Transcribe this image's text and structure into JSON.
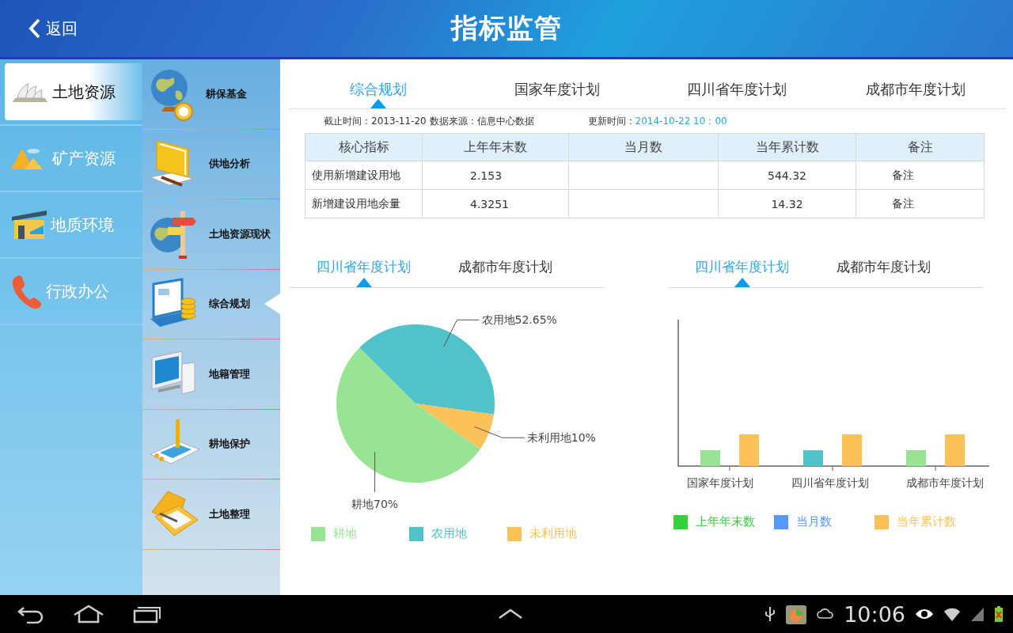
{
  "header": {
    "back": "返回",
    "title": "指标监管"
  },
  "nav": [
    {
      "label": "土地资源",
      "selected": true
    },
    {
      "label": "矿产资源",
      "selected": false
    },
    {
      "label": "地质环境",
      "selected": false
    },
    {
      "label": "行政办公",
      "selected": false
    }
  ],
  "subnav": [
    {
      "label": "耕保基金",
      "selected": false
    },
    {
      "label": "供地分析",
      "selected": false
    },
    {
      "label": "土地资源现状",
      "selected": false
    },
    {
      "label": "综合规划",
      "selected": true
    },
    {
      "label": "地籍管理",
      "selected": false
    },
    {
      "label": "耕地保护",
      "selected": false
    },
    {
      "label": "土地整理",
      "selected": false
    }
  ],
  "tabs": [
    {
      "label": "综合规划",
      "selected": true
    },
    {
      "label": "国家年度计划",
      "selected": false
    },
    {
      "label": "四川省年度计划",
      "selected": false
    },
    {
      "label": "成都市年度计划",
      "selected": false
    }
  ],
  "info": {
    "source": "截止时间：2013-11-20 数据来源：信息中心数据",
    "updated_label": "更新时间：",
    "updated_value": "2014-10-22 10：00"
  },
  "table": {
    "columns": [
      "核心指标",
      "上年年末数",
      "当月数",
      "当年累计数",
      "备注"
    ],
    "rows": [
      [
        "使用新增建设用地",
        "2.153",
        "",
        "544.32",
        "备注"
      ],
      [
        "新增建设用地余量",
        "4.3251",
        "",
        "14.32",
        "备注"
      ]
    ]
  },
  "pie_panel": {
    "tabs": [
      {
        "label": "四川省年度计划",
        "selected": true
      },
      {
        "label": "成都市年度计划",
        "selected": false
      }
    ],
    "chart_data": {
      "type": "pie",
      "values": [
        70,
        52.65,
        10
      ],
      "value_labels": [
        "耕地70%",
        "农用地52.65%",
        "未利用地10%"
      ]
    },
    "legend": [
      {
        "label": "耕地",
        "color": "#97e493"
      },
      {
        "label": "农用地",
        "color": "#4fc3c8"
      },
      {
        "label": "未利用地",
        "color": "#fdc159"
      }
    ]
  },
  "bar_panel": {
    "tabs": [
      {
        "label": "四川省年度计划",
        "selected": true
      },
      {
        "label": "成都市年度计划",
        "selected": false
      }
    ],
    "categories": [
      "国家年度计划",
      "四川省年度计划",
      "成都市年度计划"
    ],
    "legend": [
      {
        "label": "上年年末数",
        "color": "#33d13a"
      },
      {
        "label": "当月数",
        "color": "#5599ff"
      },
      {
        "label": "当年累计数",
        "color": "#fdc159"
      }
    ]
  },
  "system_bar": {
    "time": "10:06"
  }
}
